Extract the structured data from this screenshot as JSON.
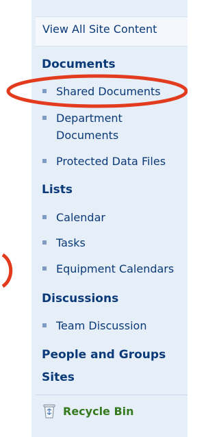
{
  "quick_launch": {
    "view_all": "View All Site Content",
    "sections": {
      "documents": {
        "heading": "Documents",
        "items": [
          "Shared Documents",
          "Department Documents",
          "Protected Data Files"
        ]
      },
      "lists": {
        "heading": "Lists",
        "items": [
          "Calendar",
          "Tasks",
          "Equipment Calendars"
        ]
      },
      "discussions": {
        "heading": "Discussions",
        "items": [
          "Team Discussion"
        ]
      }
    },
    "people_groups": "People and Groups",
    "sites": "Sites",
    "recycle_bin": "Recycle Bin"
  },
  "colors": {
    "link": "#0b3a78",
    "panel_bg": "#e6eef8",
    "recycle_green": "#357a1e",
    "annotation_red": "#e23b1e"
  },
  "icons": {
    "bullet": "square-bullet-icon",
    "recycle": "recycle-bin-icon"
  }
}
